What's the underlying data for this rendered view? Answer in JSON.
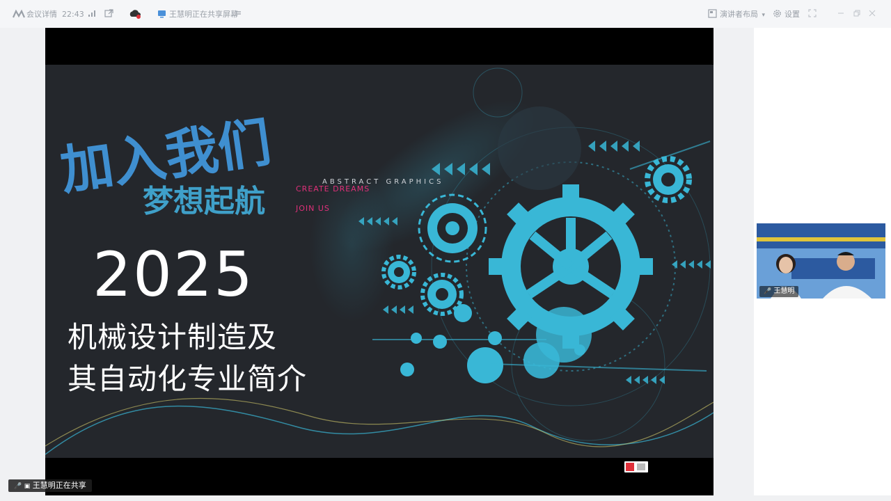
{
  "topbar": {
    "meeting_details": "会议详情",
    "elapsed_time": "22:43",
    "sharing_notice": "王慧明正在共享屏幕",
    "layout_label": "演讲者布局",
    "settings_label": "设置"
  },
  "slide": {
    "calligraphy_title": "加入我们",
    "slogan": "梦想起航",
    "create_text": "CREATE DREAMS",
    "join_text": "JOIN US",
    "abstract_text": "ABSTRACT GRAPHICS",
    "year": "2025",
    "title_line1": "机械设计制造及",
    "title_line2": "其自动化专业简介"
  },
  "participant": {
    "name": "王慧明"
  },
  "share_status": {
    "text": "王慧明正在共享"
  },
  "colors": {
    "accent_cyan": "#39b7d6",
    "slide_bg": "#24272c",
    "magenta": "#e0307a"
  }
}
